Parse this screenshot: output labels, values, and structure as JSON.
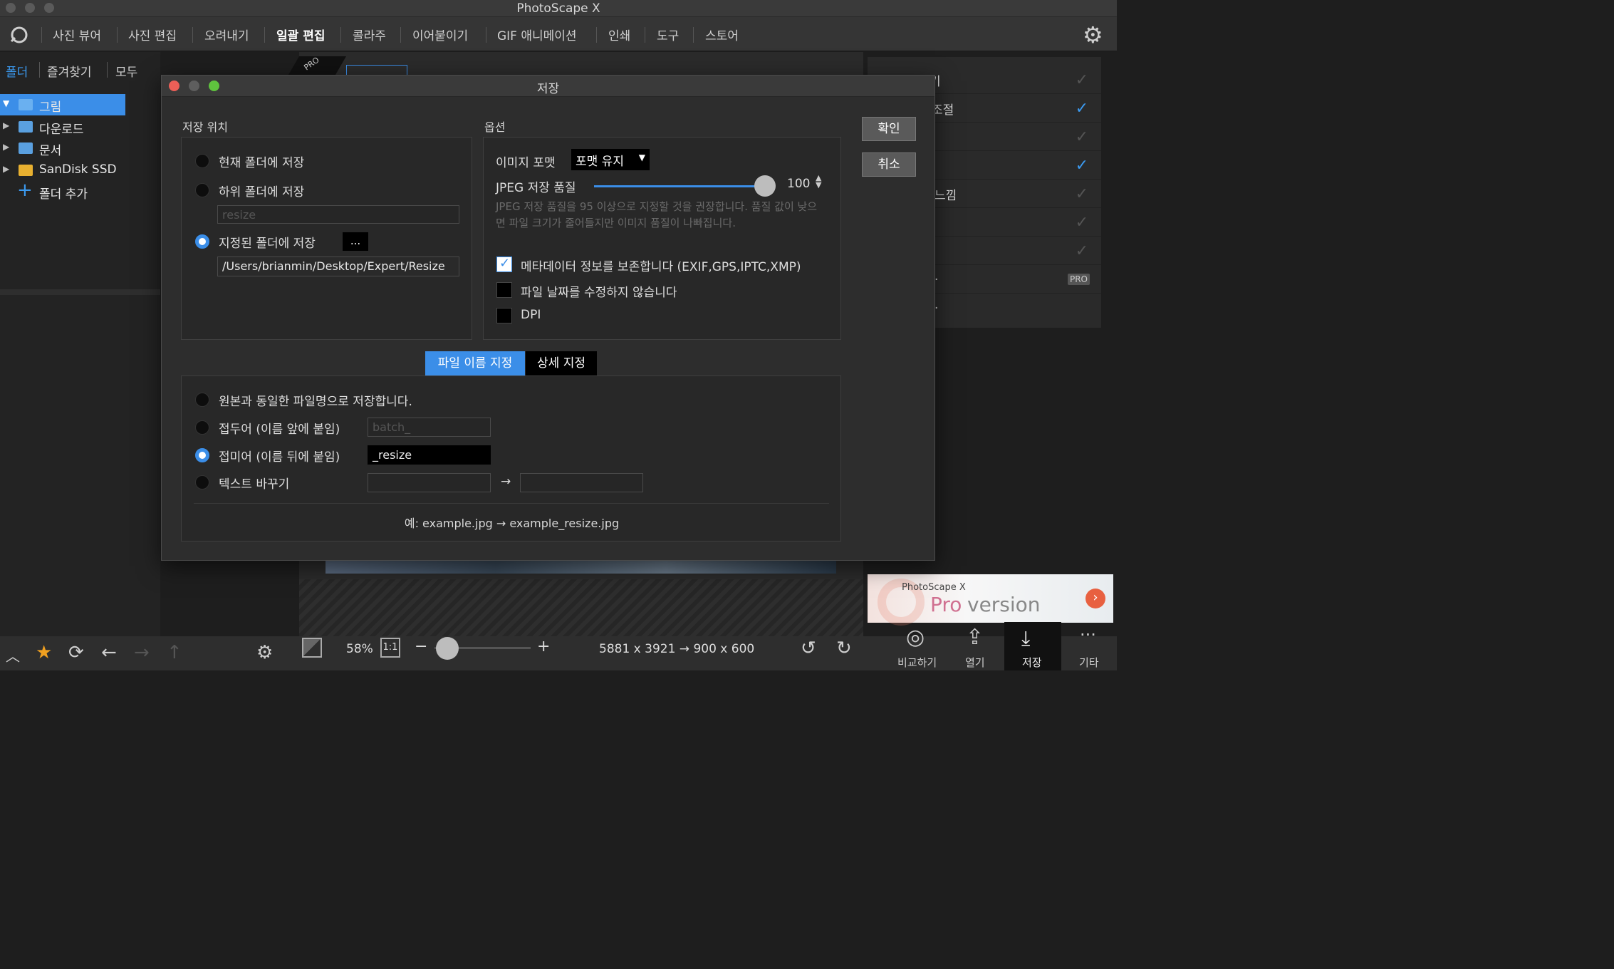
{
  "app": {
    "title": "PhotoScape X"
  },
  "topnav": {
    "items": [
      "사진 뷰어",
      "사진 편집",
      "오려내기",
      "일괄 편집",
      "콜라주",
      "이어붙이기",
      "GIF 애니메이션",
      "인쇄",
      "도구",
      "스토어"
    ]
  },
  "left": {
    "tabs": [
      "폴더",
      "즐겨찾기",
      "모두"
    ],
    "tree": [
      {
        "label": "그림",
        "selected": true
      },
      {
        "label": "다운로드"
      },
      {
        "label": "문서"
      },
      {
        "label": "SanDisk SSD"
      },
      {
        "label": "폴더 추가"
      }
    ]
  },
  "right": {
    "rows": [
      {
        "label": "…기",
        "checked": false
      },
      {
        "label": "조절",
        "checked": true
      },
      {
        "label": "",
        "checked": false
      },
      {
        "label": "",
        "checked": true
      },
      {
        "label": "느낌",
        "checked": false
      },
      {
        "label": "",
        "checked": false
      },
      {
        "label": "",
        "checked": false
      },
      {
        "label": ".",
        "badge": "PRO"
      },
      {
        "label": "."
      }
    ],
    "ad": {
      "brand": "PhotoScape X",
      "pro": "Pro",
      "version": "version"
    }
  },
  "dialog": {
    "title": "저장",
    "location": {
      "heading": "저장 위치",
      "opt_current": "현재 폴더에 저장",
      "opt_sub": "하위 폴더에 저장",
      "sub_placeholder": "resize",
      "opt_specified": "지정된 폴더에 저장",
      "browse_label": "...",
      "path": "/Users/brianmin/Desktop/Expert/Resize",
      "selected": "specified"
    },
    "options": {
      "heading": "옵션",
      "format_label": "이미지 포맷",
      "format_value": "포맷 유지",
      "quality_label": "JPEG 저장 품질",
      "quality_value": "100",
      "quality_fraction": 1.0,
      "hint": "JPEG 저장 품질을 95 이상으로 지정할 것을 권장합니다. 품질 값이 낮으면 파일 크기가 줄어들지만 이미지 품질이 나빠집니다.",
      "cb_meta": "메타데이터 정보를 보존합니다 (EXIF,GPS,IPTC,XMP)",
      "cb_meta_checked": true,
      "cb_date": "파일 날짜를 수정하지 않습니다",
      "cb_dpi": "DPI"
    },
    "buttons": {
      "ok": "확인",
      "cancel": "취소"
    },
    "tabs": {
      "naming": "파일 이름 지정",
      "detail": "상세 지정"
    },
    "naming": {
      "opt_same": "원본과 동일한 파일명으로 저장합니다.",
      "opt_prefix": "접두어 (이름 앞에 붙임)",
      "prefix_placeholder": "batch_",
      "opt_suffix": "접미어 (이름 뒤에 붙임)",
      "suffix_value": "_resize",
      "opt_replace": "텍스트 바꾸기",
      "arrow": "→",
      "example": "예: example.jpg → example_resize.jpg",
      "selected": "suffix"
    }
  },
  "bottom": {
    "zoom": "58%",
    "one_to_one": "1:1",
    "minus": "−",
    "plus": "+",
    "zoom_fraction": 0.13,
    "dimensions": "5881 x 3921 → 900 x 600",
    "actions": [
      "비교하기",
      "열기",
      "저장",
      "기타"
    ]
  }
}
